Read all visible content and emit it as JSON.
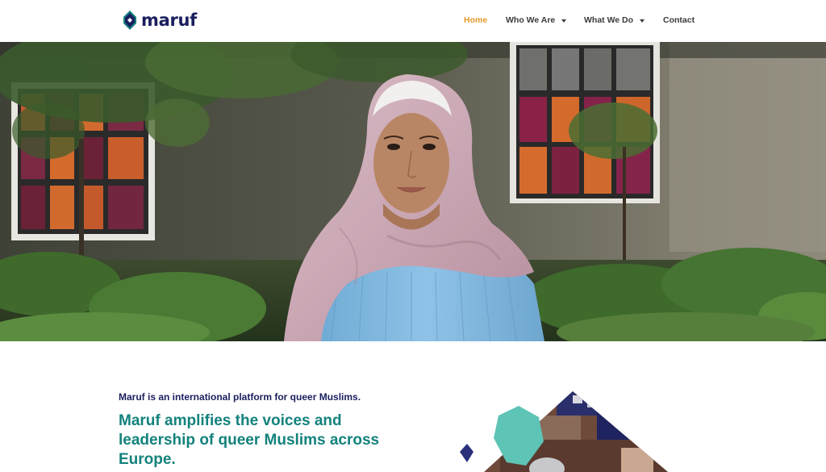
{
  "brand": {
    "name": "maruf"
  },
  "nav": {
    "items": [
      {
        "label": "Home",
        "active": true,
        "has_dropdown": false
      },
      {
        "label": "Who We Are",
        "active": false,
        "has_dropdown": true
      },
      {
        "label": "What We Do",
        "active": false,
        "has_dropdown": true
      },
      {
        "label": "Contact",
        "active": false,
        "has_dropdown": false
      }
    ]
  },
  "hero": {
    "image": "portrait-woman-hijab-garden"
  },
  "content": {
    "intro": "Maruf is an international platform for queer Muslims.",
    "headline": "Maruf amplifies the voices and leadership of queer Muslims across Europe."
  },
  "colors": {
    "brand_navy": "#1a1f5e",
    "brand_teal": "#13827c",
    "nav_active": "#e89a2c",
    "hexagon_mint": "#5ec4b6"
  }
}
